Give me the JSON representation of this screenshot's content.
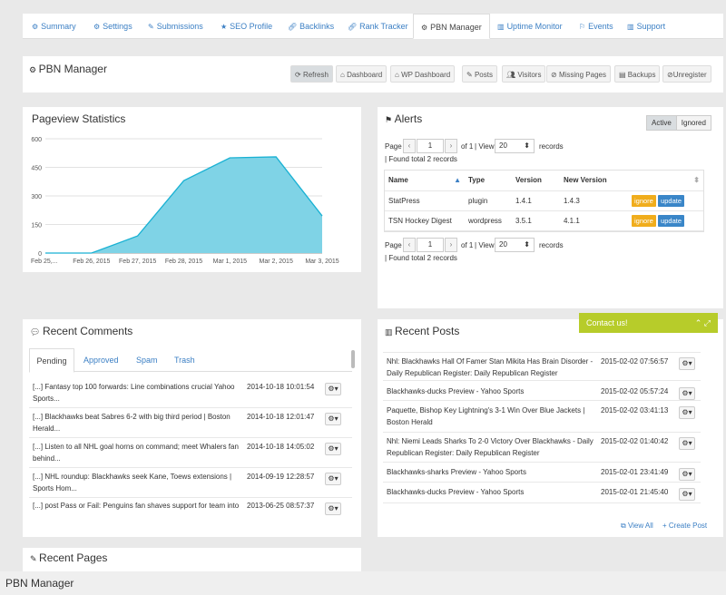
{
  "tabs": [
    {
      "label": "Summary",
      "icon": "gears-icon"
    },
    {
      "label": "Settings",
      "icon": "gears-icon"
    },
    {
      "label": "Submissions",
      "icon": "edit-icon"
    },
    {
      "label": "SEO Profile",
      "icon": "star-icon"
    },
    {
      "label": "Backlinks",
      "icon": "link-icon"
    },
    {
      "label": "Rank Tracker",
      "icon": "link-icon"
    },
    {
      "label": "PBN Manager",
      "icon": "gears-icon"
    },
    {
      "label": "Uptime Monitor",
      "icon": "chart-icon"
    },
    {
      "label": "Events",
      "icon": "pin-icon"
    },
    {
      "label": "Support",
      "icon": "chart-icon"
    }
  ],
  "header": {
    "title": "PBN Manager",
    "buttons": [
      "Refresh",
      "Dashboard",
      "WP Dashboard",
      "Posts",
      "Visitors",
      "Missing Pages",
      "Backups",
      "Unregister"
    ]
  },
  "pageview": {
    "title": "Pageview Statistics"
  },
  "chart_data": {
    "type": "area",
    "title": "Pageview Statistics",
    "x": [
      "Feb 25,...",
      "Feb 26, 2015",
      "Feb 27, 2015",
      "Feb 28, 2015",
      "Mar 1, 2015",
      "Mar 2, 2015",
      "Mar 3, 2015"
    ],
    "values": [
      0,
      0,
      90,
      380,
      500,
      505,
      195
    ],
    "yticks": [
      0,
      150,
      300,
      450,
      600
    ],
    "ylim": [
      0,
      600
    ],
    "color": "#7fd3e6",
    "line_color": "#19b1d3"
  },
  "alerts": {
    "title": "Alerts",
    "toggle": [
      "Active",
      "Ignored"
    ],
    "page_label": "Page",
    "page_value": "1",
    "of_text": "of 1",
    "view_label": "View",
    "view_value": "20",
    "records_label": "records",
    "found_text": "Found total 2 records",
    "columns": [
      "Name",
      "Type",
      "Version",
      "New Version"
    ],
    "rows": [
      {
        "name": "StatPress",
        "type": "plugin",
        "version": "1.4.1",
        "new_version": "1.4.3"
      },
      {
        "name": "TSN Hockey Digest",
        "type": "wordpress",
        "version": "3.5.1",
        "new_version": "4.1.1"
      }
    ],
    "ignore_label": "ignore",
    "update_label": "update"
  },
  "comments": {
    "title": "Recent Comments",
    "tabs": [
      "Pending",
      "Approved",
      "Spam",
      "Trash"
    ],
    "rows": [
      {
        "text": "[...] Fantasy top 100 forwards: Line combinations crucial Yahoo Sports...",
        "date": "2014-10-18 10:01:54"
      },
      {
        "text": "[...] Blackhawks beat Sabres 6-2 with big third period | Boston Herald...",
        "date": "2014-10-18 12:01:47"
      },
      {
        "text": "[...] Listen to all NHL goal horns on command; meet Whalers fan behind...",
        "date": "2014-10-18 14:05:02"
      },
      {
        "text": "[...] NHL roundup: Blackhawks seek Kane, Toews extensions | Sports Hom...",
        "date": "2014-09-19 12:28:57"
      },
      {
        "text": "[...] post Pass or Fail: Penguins fan shaves support for team into",
        "date": "2013-06-25 08:57:37"
      }
    ]
  },
  "posts": {
    "title": "Recent Posts",
    "rows": [
      {
        "text": "Nhl: Blackhawks Hall Of Famer Stan Mikita Has Brain Disorder - Daily Republican Register: Daily Republican Register",
        "date": "2015-02-02 07:56:57"
      },
      {
        "text": "Blackhawks-ducks Preview - Yahoo Sports",
        "date": "2015-02-02 05:57:24"
      },
      {
        "text": "Paquette, Bishop Key Lightning's 3-1 Win Over Blue Jackets | Boston Herald",
        "date": "2015-02-02 03:41:13"
      },
      {
        "text": "Nhl: Niemi Leads Sharks To 2-0 Victory Over Blackhawks - Daily Republican Register: Daily Republican Register",
        "date": "2015-02-02 01:40:42"
      },
      {
        "text": "Blackhawks-sharks Preview - Yahoo Sports",
        "date": "2015-02-01 23:41:49"
      },
      {
        "text": "Blackhawks-ducks Preview - Yahoo Sports",
        "date": "2015-02-01 21:45:40"
      }
    ],
    "view_all": "View All",
    "create_post": "Create Post"
  },
  "contact": {
    "label": "Contact us!",
    "controls": "⌃ ⤢"
  },
  "pages": {
    "title": "Recent Pages"
  },
  "caption": "PBN Manager"
}
